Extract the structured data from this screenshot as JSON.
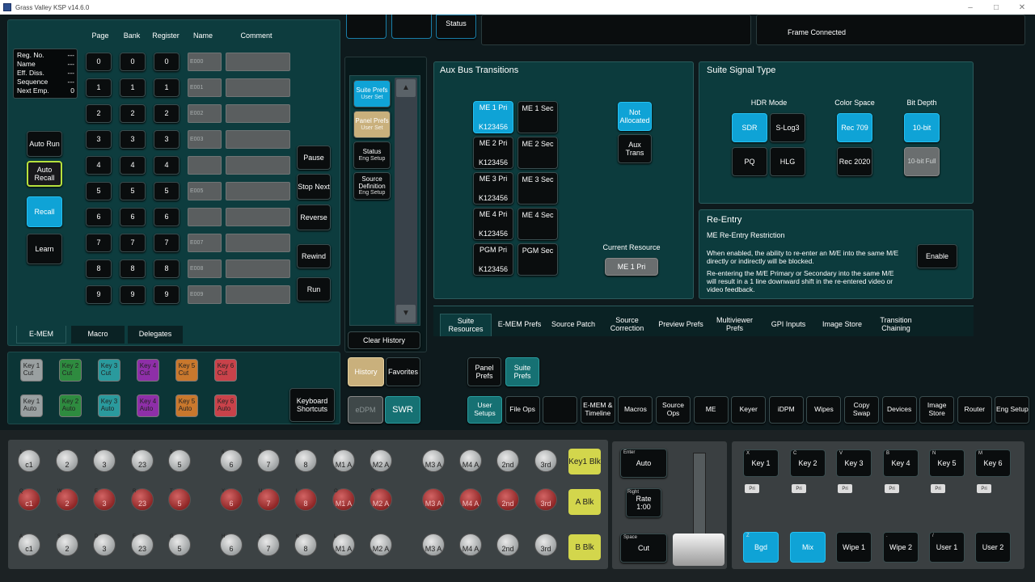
{
  "window_title": "Grass Valley KSP v14.6.0",
  "emem": {
    "headers": [
      "Page",
      "Bank",
      "Register",
      "Name",
      "Comment"
    ],
    "info_labels": [
      "Reg. No.",
      "Name",
      "Eff. Diss.",
      "Sequence",
      "Next Emp."
    ],
    "info_values": [
      "---",
      "---",
      "---",
      "---",
      "0"
    ],
    "rows": [
      "0",
      "1",
      "2",
      "3",
      "4",
      "5",
      "6",
      "7",
      "8",
      "9"
    ],
    "names": [
      "E000",
      "E001",
      "E002",
      "E003",
      "",
      "E005",
      "",
      "E007",
      "E008",
      "E009"
    ],
    "left_buttons": {
      "auto_run": "Auto Run",
      "auto_recall": "Auto Recall",
      "recall": "Recall",
      "learn": "Learn"
    },
    "right_buttons": {
      "pause": "Pause",
      "stop_next": "Stop Next",
      "reverse": "Reverse",
      "rewind": "Rewind",
      "run": "Run"
    },
    "tabs": [
      "E-MEM",
      "Macro",
      "Delegates"
    ]
  },
  "keys_panel": {
    "cut_keys": [
      "Key 1\nCut",
      "Key 2\nCut",
      "Key 3\nCut",
      "Key 4\nCut",
      "Key 5\nCut",
      "Key 6\nCut"
    ],
    "auto_keys": [
      "Key 1\nAuto",
      "Key 2\nAuto",
      "Key 3\nAuto",
      "Key 4\nAuto",
      "Key 5\nAuto",
      "Key 6\nAuto"
    ],
    "keyboard_shortcuts": "Keyboard Shortcuts"
  },
  "middle": {
    "buttons": [
      {
        "label": "Suite Prefs",
        "sub": "User Set"
      },
      {
        "label": "Panel Prefs",
        "sub": "User Set"
      },
      {
        "label": "Status",
        "sub": "Eng  Setup"
      },
      {
        "label": "Source Definition",
        "sub": "Eng  Setup"
      }
    ],
    "clear_history": "Clear History",
    "history": "History",
    "favorites": "Favorites",
    "edpm": "eDPM",
    "swr": "SWR"
  },
  "top": {
    "status_label": "Status",
    "frame_connected": "Frame Connected"
  },
  "aux_bus": {
    "title": "Aux Bus Transitions",
    "pri": [
      "ME 1 Pri",
      "ME 2 Pri",
      "ME 3 Pri",
      "ME 4 Pri",
      "PGM Pri"
    ],
    "sec": [
      "ME 1 Sec",
      "ME 2 Sec",
      "ME 3 Sec",
      "ME 4 Sec",
      "PGM Sec"
    ],
    "code": "K123456",
    "not_allocated": "Not Allocated",
    "aux_trans": "Aux Trans",
    "current_resource_label": "Current Resource",
    "current_resource_value": "ME 1 Pri"
  },
  "signal": {
    "title": "Suite Signal Type",
    "hdr_label": "HDR Mode",
    "color_label": "Color Space",
    "bit_label": "Bit Depth",
    "hdr": [
      "SDR",
      "S-Log3",
      "PQ",
      "HLG"
    ],
    "color": [
      "Rec 709",
      "Rec 2020"
    ],
    "bit": [
      "10-bit",
      "10-bit Full"
    ]
  },
  "reentry": {
    "title": "Re-Entry",
    "subtitle": "ME Re-Entry Restriction",
    "text1": "When enabled, the ability to re-enter an M/E into the same M/E directly or indirectly will be blocked.",
    "text2": "Re-entering the M/E Primary or Secondary into the same M/E will result in a 1 line downward shift in the re-entered video or video feedback.",
    "enable": "Enable"
  },
  "pref_tabs": [
    "Suite Resources",
    "E-MEM Prefs",
    "Source Patch",
    "Source Correction",
    "Preview Prefs",
    "Multiviewer Prefs",
    "GPI Inputs",
    "Image Store",
    "Transition Chaining"
  ],
  "pref_buttons": {
    "panel": "Panel Prefs",
    "suite": "Suite Prefs"
  },
  "menu_tabs": [
    "User Setups",
    "File Ops",
    "",
    "E-MEM & Timeline",
    "Macros",
    "Source Ops",
    "ME",
    "Keyer",
    "iDPM",
    "Wipes",
    "Copy Swap",
    "Devices",
    "Image Store",
    "Router",
    "Eng Setup"
  ],
  "crosspoints": {
    "row1": [
      "c1",
      "2",
      "3",
      "23",
      "5",
      "6",
      "7",
      "8",
      "M1 A",
      "M2 A",
      "M3 A",
      "M4 A",
      "2nd",
      "3rd"
    ],
    "row1_small": [
      "1",
      "2",
      "3",
      "4",
      "5",
      "6",
      "7",
      "8",
      "9",
      "0",
      "",
      "",
      "",
      ""
    ],
    "row3": [
      "c1",
      "2",
      "3",
      "23",
      "5",
      "6",
      "7",
      "8",
      "M1 A",
      "M2 A",
      "M3 A",
      "M4 A",
      "2nd",
      "3rd"
    ],
    "row3_small": [
      "A",
      "S",
      "D",
      "F",
      "G",
      "H",
      "J",
      "K",
      "L",
      ";",
      "",
      "",
      "",
      ""
    ],
    "row2_small": [
      "Q",
      "W",
      "E",
      "R",
      "T",
      "Y",
      "U",
      "I",
      "O",
      "P",
      "",
      "",
      "",
      ""
    ],
    "row2": [
      "c1",
      "2",
      "3",
      "23",
      "5",
      "6",
      "7",
      "8",
      "M1 A",
      "M2 A",
      "M3 A",
      "M4 A",
      "2nd",
      "3rd"
    ],
    "yellow": [
      "Key1 Blk",
      "A Blk",
      "B Blk"
    ]
  },
  "trans": {
    "enter": "Enter",
    "auto": "Auto",
    "right": "Right",
    "rate": "Rate 1:00",
    "space": "Space",
    "cut": "Cut"
  },
  "keyers": {
    "keys": [
      "Key 1",
      "Key 2",
      "Key 3",
      "Key 4",
      "Key 5",
      "Key 6"
    ],
    "letters": [
      "X",
      "C",
      "V",
      "B",
      "N",
      "M"
    ],
    "pri": "Pri",
    "bottom": [
      "Bgd",
      "Mix",
      "Wipe 1",
      "Wipe 2",
      "User 1",
      "User 2"
    ],
    "bottom_letters": [
      "Z",
      "",
      "",
      ".",
      "/",
      ""
    ]
  }
}
